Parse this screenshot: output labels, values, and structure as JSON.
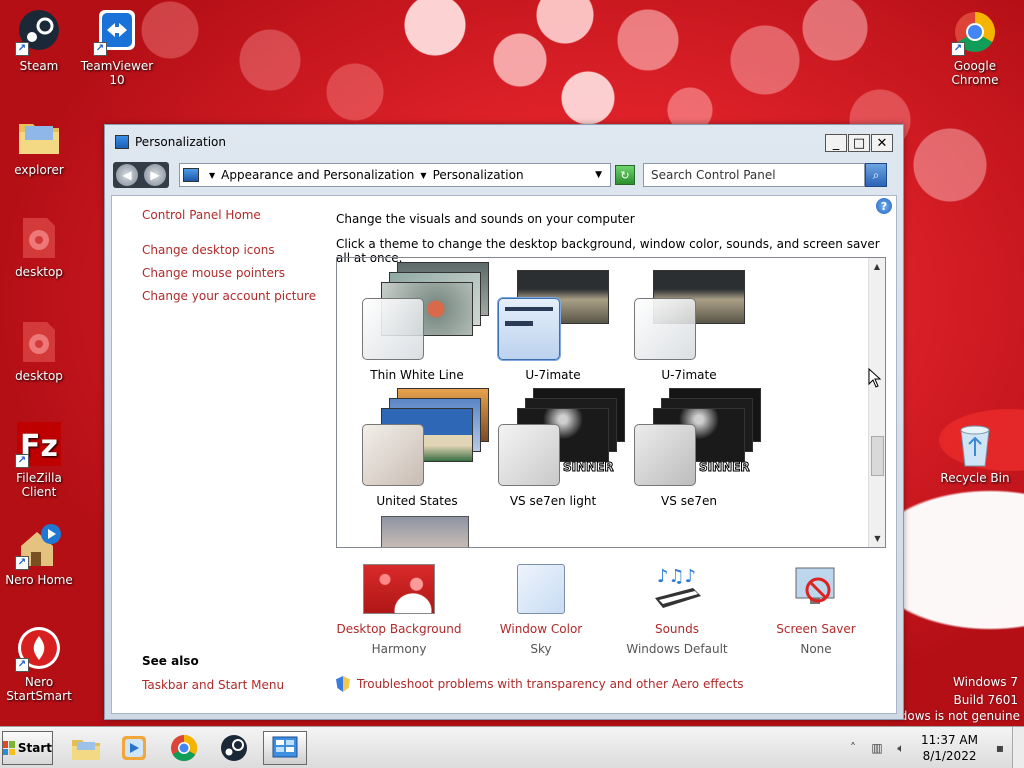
{
  "desktop": {
    "icons_left": [
      {
        "label": "Steam",
        "icon": "steam-icon"
      },
      {
        "label": "TeamViewer 10",
        "icon": "teamviewer-icon"
      },
      {
        "label": "explorer",
        "icon": "folder-icon"
      },
      {
        "label": "desktop",
        "icon": "gear-icon"
      },
      {
        "label": "desktop",
        "icon": "gear-icon"
      },
      {
        "label": "FileZilla Client",
        "icon": "filezilla-icon"
      },
      {
        "label": "Nero Home",
        "icon": "nero-home-icon"
      },
      {
        "label": "Nero StartSmart",
        "icon": "nero-startsmart-icon"
      }
    ],
    "icons_right": [
      {
        "label": "Google Chrome",
        "icon": "chrome-icon"
      },
      {
        "label": "Recycle Bin",
        "icon": "recycle-bin-icon"
      }
    ],
    "watermark": {
      "line1": "Windows 7",
      "line2": "Build 7601",
      "line3": "indows is not genuine"
    }
  },
  "window": {
    "title": "Personalization",
    "controls": {
      "minimize": "_",
      "maximize": "□",
      "close": "✕"
    },
    "address": {
      "crumb1": "Appearance and Personalization",
      "crumb2": "Personalization"
    },
    "search_placeholder": "Search Control Panel",
    "sidebar": {
      "home": "Control Panel Home",
      "links": [
        "Change desktop icons",
        "Change mouse pointers",
        "Change your account picture"
      ],
      "see_also_title": "See also",
      "see_also_links": [
        "Taskbar and Start Menu"
      ]
    },
    "heading": "Change the visuals and sounds on your computer",
    "subheading": "Click a theme to change the desktop background, window color, sounds, and screen saver all at once.",
    "themes": [
      {
        "name": "Thin White Line",
        "selected": false
      },
      {
        "name": "U-7imate",
        "selected": true
      },
      {
        "name": "U-7imate",
        "selected": false
      },
      {
        "name": "United States",
        "selected": false
      },
      {
        "name": "VS se7en light",
        "selected": false
      },
      {
        "name": "VS se7en",
        "selected": false
      }
    ],
    "theme_watermark": "SINNER",
    "settings": [
      {
        "label": "Desktop Background",
        "value": "Harmony",
        "icon": "desktop-background-thumbnail"
      },
      {
        "label": "Window Color",
        "value": "Sky",
        "icon": "window-color-swatch"
      },
      {
        "label": "Sounds",
        "value": "Windows Default",
        "icon": "sounds-icon"
      },
      {
        "label": "Screen Saver",
        "value": "None",
        "icon": "screen-saver-icon"
      }
    ],
    "troubleshoot": "Troubleshoot problems with transparency and other Aero effects",
    "link_color": "#b02a2a"
  },
  "taskbar": {
    "start_label": "Start",
    "apps": [
      "explorer",
      "media-player",
      "chrome",
      "steam",
      "control-panel"
    ],
    "clock_time": "11:37 AM",
    "clock_date": "8/1/2022"
  }
}
